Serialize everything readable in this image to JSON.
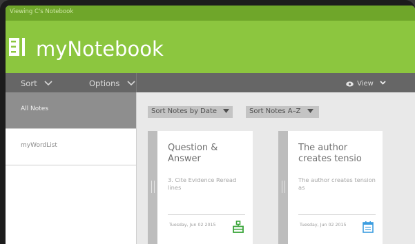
{
  "window": {
    "title": "Viewing C's Notebook"
  },
  "app": {
    "brand": "myNotebook",
    "logo_icon": "notebook-icon"
  },
  "toolbar": {
    "sort_label": "Sort",
    "options_label": "Options",
    "view_label": "View",
    "view_icon": "eye-icon"
  },
  "sidebar": {
    "items": [
      {
        "label": "All Notes",
        "selected": true
      },
      {
        "label": "myWordList",
        "selected": false
      }
    ]
  },
  "content": {
    "sort_by_date_label": "Sort Notes by Date",
    "sort_alpha_label": "Sort Notes A–Z",
    "notes": [
      {
        "title": "Question & Answer",
        "snippet": "3. Cite Evidence Reread lines",
        "date": "Tuesday, Jun 02 2015",
        "type_icon": "green-note-type-icon",
        "icon_color": "#3aa53a"
      },
      {
        "title": "The author creates tensio",
        "snippet": "The author creates tension as",
        "date": "Tuesday, Jun 02 2015",
        "type_icon": "calendar-icon",
        "icon_color": "#3b9de0"
      }
    ]
  },
  "colors": {
    "accent": "#8cc63f",
    "titlebar": "#6fa62a",
    "toolbar": "#666666",
    "sidebar_selected": "#8e8e8e"
  }
}
